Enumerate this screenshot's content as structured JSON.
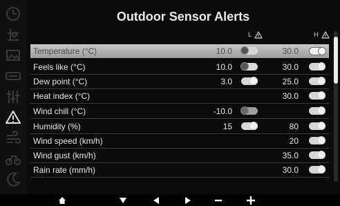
{
  "screen": {
    "title": "Outdoor Sensor Alerts",
    "low_header": "L",
    "high_header": "H"
  },
  "sidebar": {
    "icons": [
      "clock-icon",
      "forecast-icon",
      "picture-icon",
      "gauge-icon",
      "settings-icon",
      "warning-icon",
      "wind-icon",
      "bicycle-icon",
      "moon-icon"
    ],
    "active": "warning-icon"
  },
  "rows": [
    {
      "label": "Temperature (°C)",
      "low": "10.0",
      "high": "30.0",
      "low_toggle": "on",
      "high_toggle": "off",
      "selected": true
    },
    {
      "label": "Feels like (°C)",
      "low": "10.0",
      "high": "30.0",
      "low_toggle": "on",
      "high_toggle": "off"
    },
    {
      "label": "Dew point (°C)",
      "low": "3.0",
      "high": "25.0",
      "low_toggle": "off",
      "high_toggle": "off"
    },
    {
      "label": "Heat index (°C)",
      "low": "",
      "high": "30.0",
      "low_toggle": "",
      "high_toggle": "off"
    },
    {
      "label": "Wind chill (°C)",
      "low": "-10.0",
      "high": "",
      "low_toggle": "on",
      "high_toggle": "off"
    },
    {
      "label": "Humidity (%)",
      "low": "15",
      "high": "80",
      "low_toggle": "off",
      "high_toggle": "off"
    },
    {
      "label": "Wind speed  (km/h)",
      "low": "",
      "high": "20",
      "low_toggle": "",
      "high_toggle": "off"
    },
    {
      "label": "Wind gust  (km/h)",
      "low": "",
      "high": "35.0",
      "low_toggle": "",
      "high_toggle": "off"
    },
    {
      "label": "Rain rate  (mm/h)",
      "low": "",
      "high": "30.0",
      "low_toggle": "",
      "high_toggle": "off"
    }
  ],
  "bottom_bar": {
    "buttons": [
      "home-icon",
      "down-arrow-icon",
      "left-arrow-icon",
      "right-arrow-icon",
      "minus-icon",
      "plus-icon"
    ]
  }
}
